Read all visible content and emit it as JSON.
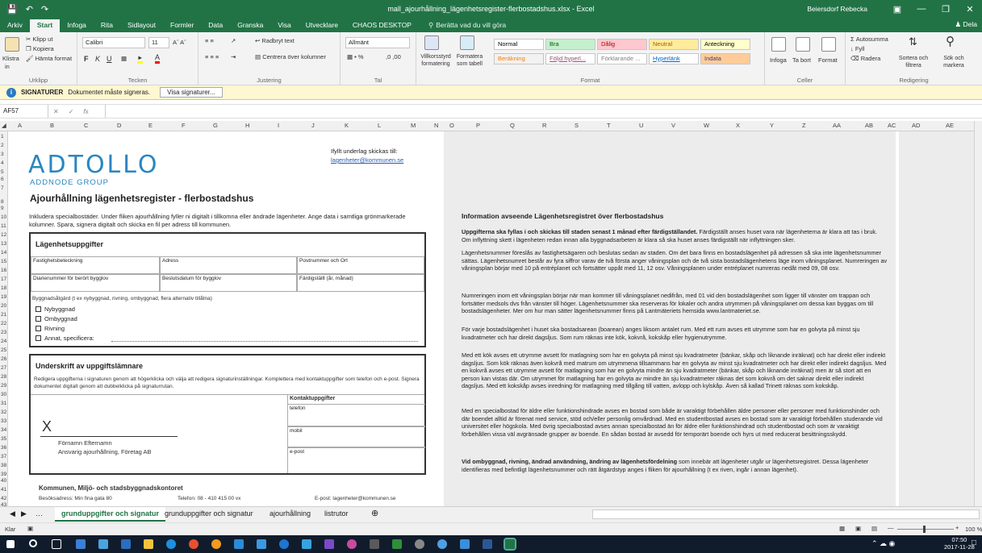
{
  "titlebar": {
    "title": "mall_ajourhållning_lägenhetsregister-flerbostadshus.xlsx - Excel",
    "user": "Beiersdorf Rebecka"
  },
  "tabs": [
    "Arkiv",
    "Start",
    "Infoga",
    "Rita",
    "Sidlayout",
    "Formler",
    "Data",
    "Granska",
    "Visa",
    "Utvecklare",
    "CHAOS DESKTOP"
  ],
  "tellme": "Berätta vad du vill göra",
  "share": "Dela",
  "ribbon": {
    "clipboard": {
      "paste": "Klistra",
      "paste2": "in",
      "cut": "Klipp ut",
      "copy": "Kopiera",
      "format": "Hämta format",
      "label": "Urklipp"
    },
    "font": {
      "name": "Calibri",
      "size": "11",
      "label": "Tecken"
    },
    "align": {
      "wrap": "Radbryt text",
      "merge": "Centrera över kolumner",
      "label": "Justering"
    },
    "number": {
      "format": "Allmänt",
      "label": "Tal"
    },
    "styles": {
      "cond": "Villkorsstyrd formatering",
      "table": "Formatera som tabell",
      "label": "Format",
      "items": [
        {
          "t": "Normal",
          "bg": "#ffffff",
          "c": "#000000"
        },
        {
          "t": "Bra",
          "bg": "#c6efce",
          "c": "#006100"
        },
        {
          "t": "Dålig",
          "bg": "#ffc7ce",
          "c": "#9c0006"
        },
        {
          "t": "Neutral",
          "bg": "#ffeb9c",
          "c": "#9c6500"
        },
        {
          "t": "Anteckning",
          "bg": "#ffffcc",
          "c": "#000000"
        },
        {
          "t": "Beräkning",
          "bg": "#f2f2f2",
          "c": "#fa7d00"
        },
        {
          "t": "Följd hyperl...",
          "bg": "#ffffff",
          "c": "#954f72"
        },
        {
          "t": "Förklarande ...",
          "bg": "#ffffff",
          "c": "#7f7f7f"
        },
        {
          "t": "Hyperlänk",
          "bg": "#ffffff",
          "c": "#0563c1"
        },
        {
          "t": "Indata",
          "bg": "#ffcc99",
          "c": "#3f3f76"
        }
      ]
    },
    "cells": {
      "insert": "Infoga",
      "delete": "Ta bort",
      "format": "Format",
      "label": "Celler"
    },
    "editing": {
      "autosum": "Autosumma",
      "fill": "Fyll",
      "clear": "Radera",
      "sort": "Sortera och filtrera",
      "find": "Sök och markera",
      "label": "Redigering"
    }
  },
  "message": {
    "title": "SIGNATURER",
    "text": "Dokumentet måste signeras.",
    "button": "Visa signaturer..."
  },
  "formula": {
    "namebox": "AF57",
    "value": ""
  },
  "columns": [
    "A",
    "B",
    "C",
    "D",
    "E",
    "F",
    "G",
    "H",
    "I",
    "J",
    "K",
    "L",
    "M",
    "N",
    "O",
    "P",
    "Q",
    "R",
    "S",
    "T",
    "U",
    "V",
    "W",
    "X",
    "Y",
    "Z",
    "AA",
    "AB",
    "AC",
    "AD",
    "AE"
  ],
  "rows": [
    "1",
    "2",
    "3",
    "4",
    "5",
    "6",
    "7",
    "8",
    "9",
    "10",
    "11",
    "12",
    "13",
    "14",
    "15",
    "16",
    "17",
    "18",
    "19",
    "20",
    "21",
    "22",
    "23",
    "24",
    "25",
    "26",
    "27",
    "28",
    "29",
    "30",
    "31",
    "32",
    "33",
    "34",
    "35",
    "36",
    "37",
    "38",
    "39",
    "40",
    "41",
    "42",
    "43"
  ],
  "doc": {
    "logo": "ADTOLLO",
    "logosub": "ADDNODE GROUP",
    "heading": "Ajourhållning lägenhetsregister - flerbostadshus",
    "sendto": "Ifyllt underlag skickas till:",
    "email": "lagenheter@kommunen.se",
    "intro": "Inkludera specialbostäder. Under fliken ajourhållning fyller ni digitalt i tillkomna eller ändrade lägenheter. Ange data i samtliga grönmarkerade kolumner. Spara, signera digitalt och skicka en fil per adress till kommunen.",
    "apt_title": "Lägenhetsuppgifter",
    "f_prop": "Fastighetsbeteckning",
    "f_addr": "Adress",
    "f_post": "Postnummer och Ort",
    "f_diar": "Diarienummer för berört bygglov",
    "f_date": "Beslutsdatum för bygglov",
    "f_done": "Färdigställt (år, månad)",
    "measure": "Byggnadsåtgärd (t ex nybyggnad, rivning, ombyggnad, flera alternativ tillåtna)",
    "checks": [
      "Nybyggnad",
      "Ombyggnad",
      "Rivning",
      "Annat, specificera:"
    ],
    "sig_title": "Underskrift av uppgiftslämnare",
    "sig_text": "Redigera uppgifterna i signaturen genom att högerklicka och välja att redigera signaturinställningar. Komplettera med kontaktuppgifter som telefon och e-post. Signera dokumentet digitalt genom att dubbelklicka på signaturrutan.",
    "x": "X",
    "signame": "Förnamn Efternamn",
    "sigrole": "Ansvarig ajourhållning, Företag AB",
    "contact": "Kontaktuppgifter",
    "phone": "telefon",
    "mobile": "mobil",
    "mail": "e-post",
    "footer_org": "Kommunen, Miljö- och stadsbyggnadskontoret",
    "footer_addr": "Besöksadress: Min fina gata 80",
    "footer_tel": "Telefon: 08 - 410 415 00 vx",
    "footer_mail": "E-post: lagenheter@kommunen.se"
  },
  "info": {
    "title": "Information avseende Lägenhetsregistret över flerbostadshus",
    "p1b": "Uppgifterna ska fyllas i och skickas till staden senast 1 månad efter färdigställandet.",
    "p1": " Färdigställt anses huset vara när lägenheterna är klara att tas i bruk. Om inflyttning skett i lägenheten redan innan alla byggnadsarbeten är klara så ska huset anses färdigställt när inflyttningen sker.",
    "p2": "Lägenhetsnummer föreslås av fastighetsägaren och beslutas sedan av staden. Om det bara finns en bostadslägenhet på adressen så ska inte lägenhetsnummer sättas. Lägenhetsnumret består av fyra siffror varav de två första anger våningsplan och de två sista bostadslägenhetens läge inom våningsplanet. Numreringen av våningsplan börjar med 10 på entréplanet och fortsätter uppåt med 11, 12 osv. Våningsplanen under entréplanet numreras nedåt med 09, 08 osv.",
    "p3": "Numreringen inom ett våningsplan börjar när man kommer till våningsplanet nedifrån, med 01 vid den bostadslägenhet som ligger till vänster om trappan och fortsätter medsols dvs från vänster till höger. Lägenhetsnummer ska reserveras för lokaler och andra utrymmen på våningsplanet om dessa kan byggas om till bostadslägenheter. Mer om hur man sätter lägenhetsnummer finns på Lantmäteriets hemsida www.lantmateriet.se.",
    "p4": "För varje bostadslägenhet i huset ska bostadsarean (boarean) anges liksom antalet rum. Med ett rum avses ett utrymme som har en golvyta på minst sju kvadratmeter och har direkt dagsljus. Som rum räknas inte kök, kokvrå, kokskåp eller hygienutrymme.",
    "p5": "Med ett kök avses ett utrymme avsett för matlagning som har en golvyta på minst sju kvadratmeter (bänkar, skåp och liknande inräknat) och har direkt eller indirekt dagsljus. Som kök räknas även kokvrå med matrum om utrymmena tillsammans har en golvyta av minst sju kvadratmeter och har direkt eller indirekt dagsljus. Med en kokvrå avses ett utrymme avsett för matlagning som har en golvyta mindre än sju kvadratmeter (bänkar, skåp och liknande inräknat) men är så stort att en person kan vistas där. Om utrymmet för matlagning har en golvyta av mindre än sju kvadratmeter räknas det som kokvrå om det saknar direkt eller indirekt dagsljus. Med ett kokskåp avses inredning för matlagning med tillgång till vatten, avlopp och kylskåp. Även så kallad Trinett räknas som kokskåp.",
    "p6": "Med en specialbostad för äldre eller funktionshindrade avses en bostad som både är varaktigt förbehållen äldre personer eller personer med funktionshinder och där boendet alltid är förenat med service, stöd och/eller personlig omvårdnad. Med en studentbostad avses en bostad som är varaktigt förbehållen studerande vid universitet eller högskola. Med övrig specialbostad avses annan specialbostad än för äldre eller funktionshindrad och studentbostad och som är varaktigt förbehållen vissa väl avgränsade grupper av boende. En sådan bostad är avsedd för temporärt boende och hyrs ut med reducerat besittningsskydd.",
    "p7b": "Vid ombyggnad, rivning, ändrad användning, ändring av lägenhetsfördelning",
    "p7": " som innebär att lägenheter utgår ur lägenhetsregistret. Dessa lägenheter identifieras med befintligt lägenhetsnummer och rätt åtgärdstyp anges i fliken för ajourhållning (t ex riven, ingår i annan lägenhet)."
  },
  "sheets": [
    "grunduppgifter och signatur",
    "grunduppgifter och signatur",
    "ajourhållning",
    "listrutor"
  ],
  "status": {
    "mode": "Klar",
    "zoom": "100 %"
  },
  "clock": {
    "time": "07:50",
    "date": "2017-11-28"
  }
}
